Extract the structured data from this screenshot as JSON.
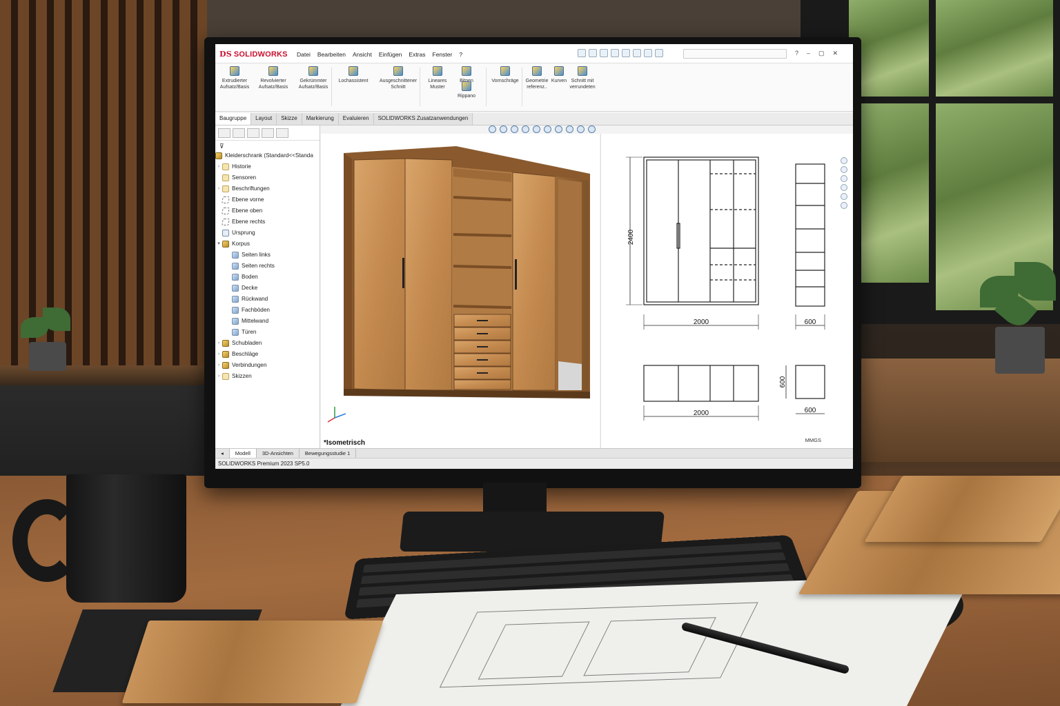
{
  "app": {
    "name": "SOLIDWORKS",
    "status_bar": "SOLIDWORKS Premium 2023 SP5.0",
    "units": "MMGS"
  },
  "menu": [
    "Datei",
    "Bearbeiten",
    "Ansicht",
    "Einfügen",
    "Extras",
    "Fenster",
    "?"
  ],
  "ribbon": [
    {
      "label": "Extrudierter Aufsatz/Basis",
      "icon": "extrude-icon"
    },
    {
      "label": "Revolvierter Aufsatz/Basis",
      "icon": "revolve-icon"
    },
    {
      "label": "Gekrümmter Aufsatz/Basis",
      "icon": "sweep-icon"
    },
    {
      "label": "Lochassistent",
      "icon": "hole-wizard-icon"
    },
    {
      "label": "Ausgeschnittener Schnitt",
      "icon": "cut-icon"
    },
    {
      "label": "Lineares Muster",
      "icon": "linear-pattern-icon"
    },
    {
      "label": "Bitpen",
      "icon": "fillet-icon"
    },
    {
      "label": "Rippano",
      "icon": "rib-icon"
    },
    {
      "label": "Vornschräge",
      "icon": "draft-icon"
    },
    {
      "label": "Geometrie referenz..",
      "icon": "reference-geometry-icon"
    },
    {
      "label": "Kurven",
      "icon": "curves-icon"
    },
    {
      "label": "Schnitt mit verrundeten",
      "icon": "section-icon"
    }
  ],
  "tabs": [
    "Baugruppe",
    "Layout",
    "Skizze",
    "Markierung",
    "Evaluieren",
    "SOLIDWORKS Zusatzanwendungen"
  ],
  "tree": {
    "root": "Kleiderschrank (Standard<<Standa",
    "items": [
      {
        "label": "Historie",
        "icon": "folder",
        "level": 0,
        "arrow": "›"
      },
      {
        "label": "Sensoren",
        "icon": "folder",
        "level": 0,
        "arrow": ""
      },
      {
        "label": "Beschriftungen",
        "icon": "folder",
        "level": 0,
        "arrow": "›"
      },
      {
        "label": "Ebene vorne",
        "icon": "plane",
        "level": 0,
        "arrow": ""
      },
      {
        "label": "Ebene oben",
        "icon": "plane",
        "level": 0,
        "arrow": ""
      },
      {
        "label": "Ebene rechts",
        "icon": "plane",
        "level": 0,
        "arrow": ""
      },
      {
        "label": "Ursprung",
        "icon": "origin",
        "level": 0,
        "arrow": ""
      },
      {
        "label": "Korpus",
        "icon": "asm",
        "level": 0,
        "arrow": "▾"
      },
      {
        "label": "Seiten links",
        "icon": "feat",
        "level": 1,
        "arrow": ""
      },
      {
        "label": "Seiten rechts",
        "icon": "feat",
        "level": 1,
        "arrow": ""
      },
      {
        "label": "Boden",
        "icon": "feat",
        "level": 1,
        "arrow": ""
      },
      {
        "label": "Decke",
        "icon": "feat",
        "level": 1,
        "arrow": ""
      },
      {
        "label": "Rückwand",
        "icon": "feat",
        "level": 1,
        "arrow": ""
      },
      {
        "label": "Fachböden",
        "icon": "feat",
        "level": 1,
        "arrow": ""
      },
      {
        "label": "Mittelwand",
        "icon": "feat",
        "level": 1,
        "arrow": ""
      },
      {
        "label": "Türen",
        "icon": "feat",
        "level": 1,
        "arrow": ""
      },
      {
        "label": "Schubladen",
        "icon": "asm",
        "level": 0,
        "arrow": "›"
      },
      {
        "label": "Beschläge",
        "icon": "asm",
        "level": 0,
        "arrow": "›"
      },
      {
        "label": "Verbindungen",
        "icon": "asm",
        "level": 0,
        "arrow": "›"
      },
      {
        "label": "Skizzen",
        "icon": "folder",
        "level": 0,
        "arrow": "›"
      }
    ]
  },
  "viewport": {
    "view_label": "*Isometrisch"
  },
  "drawing": {
    "front_height": "2400",
    "front_width": "2000",
    "side_width": "600",
    "top_width": "2000",
    "top_depth": "600",
    "top_side_width": "600"
  },
  "bottom_tabs": [
    "Modell",
    "3D-Ansichten",
    "Bewegungsstudie 1"
  ],
  "colors": {
    "brand": "#c8102e",
    "wood": "#c8935a",
    "accent": "#4a8fd1"
  }
}
